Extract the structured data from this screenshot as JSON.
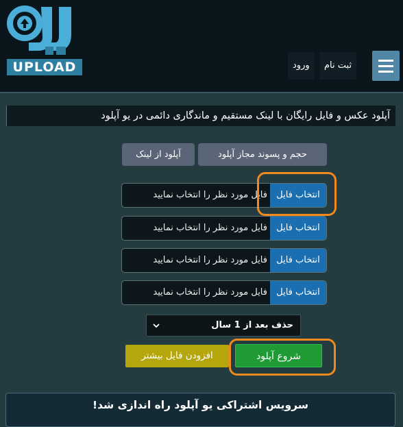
{
  "header": {
    "logo_text": "UPLOAD",
    "nav": {
      "register_label": "ثبت نام",
      "login_label": "ورود"
    },
    "menu_icon": "hamburger-icon"
  },
  "banner": {
    "text": "آپلود عکس و فایل رایگان با لینک مستقیم و ماندگاری دائمی در یو آپلود"
  },
  "tabs": {
    "size_label": "حجم و پسوند مجاز آپلود",
    "link_label": "آپلود از لینک"
  },
  "file_rows": [
    {
      "button": "انتخاب فایل",
      "placeholder": "فایل مورد نظر را انتخاب نمایید"
    },
    {
      "button": "انتخاب فایل",
      "placeholder": "فایل مورد نظر را انتخاب نمایید"
    },
    {
      "button": "انتخاب فایل",
      "placeholder": "فایل مورد نظر را انتخاب نمایید"
    },
    {
      "button": "انتخاب فایل",
      "placeholder": "فایل مورد نظر را انتخاب نمایید"
    }
  ],
  "expiry": {
    "selected": "حذف بعد از 1 سال"
  },
  "actions": {
    "start_label": "شروع آپلود",
    "more_label": "افزودن فایل بیشتر"
  },
  "footer": {
    "announcement": "سرویس اشتراکی یو آپلود راه اندازی شد!"
  },
  "colors": {
    "background": "#243b40",
    "header": "#0b151c",
    "accent_blue": "#1b6fb0",
    "start_green": "#1f9a35",
    "more_yellow": "#b5a60e",
    "highlight_orange": "#f08a1e"
  }
}
